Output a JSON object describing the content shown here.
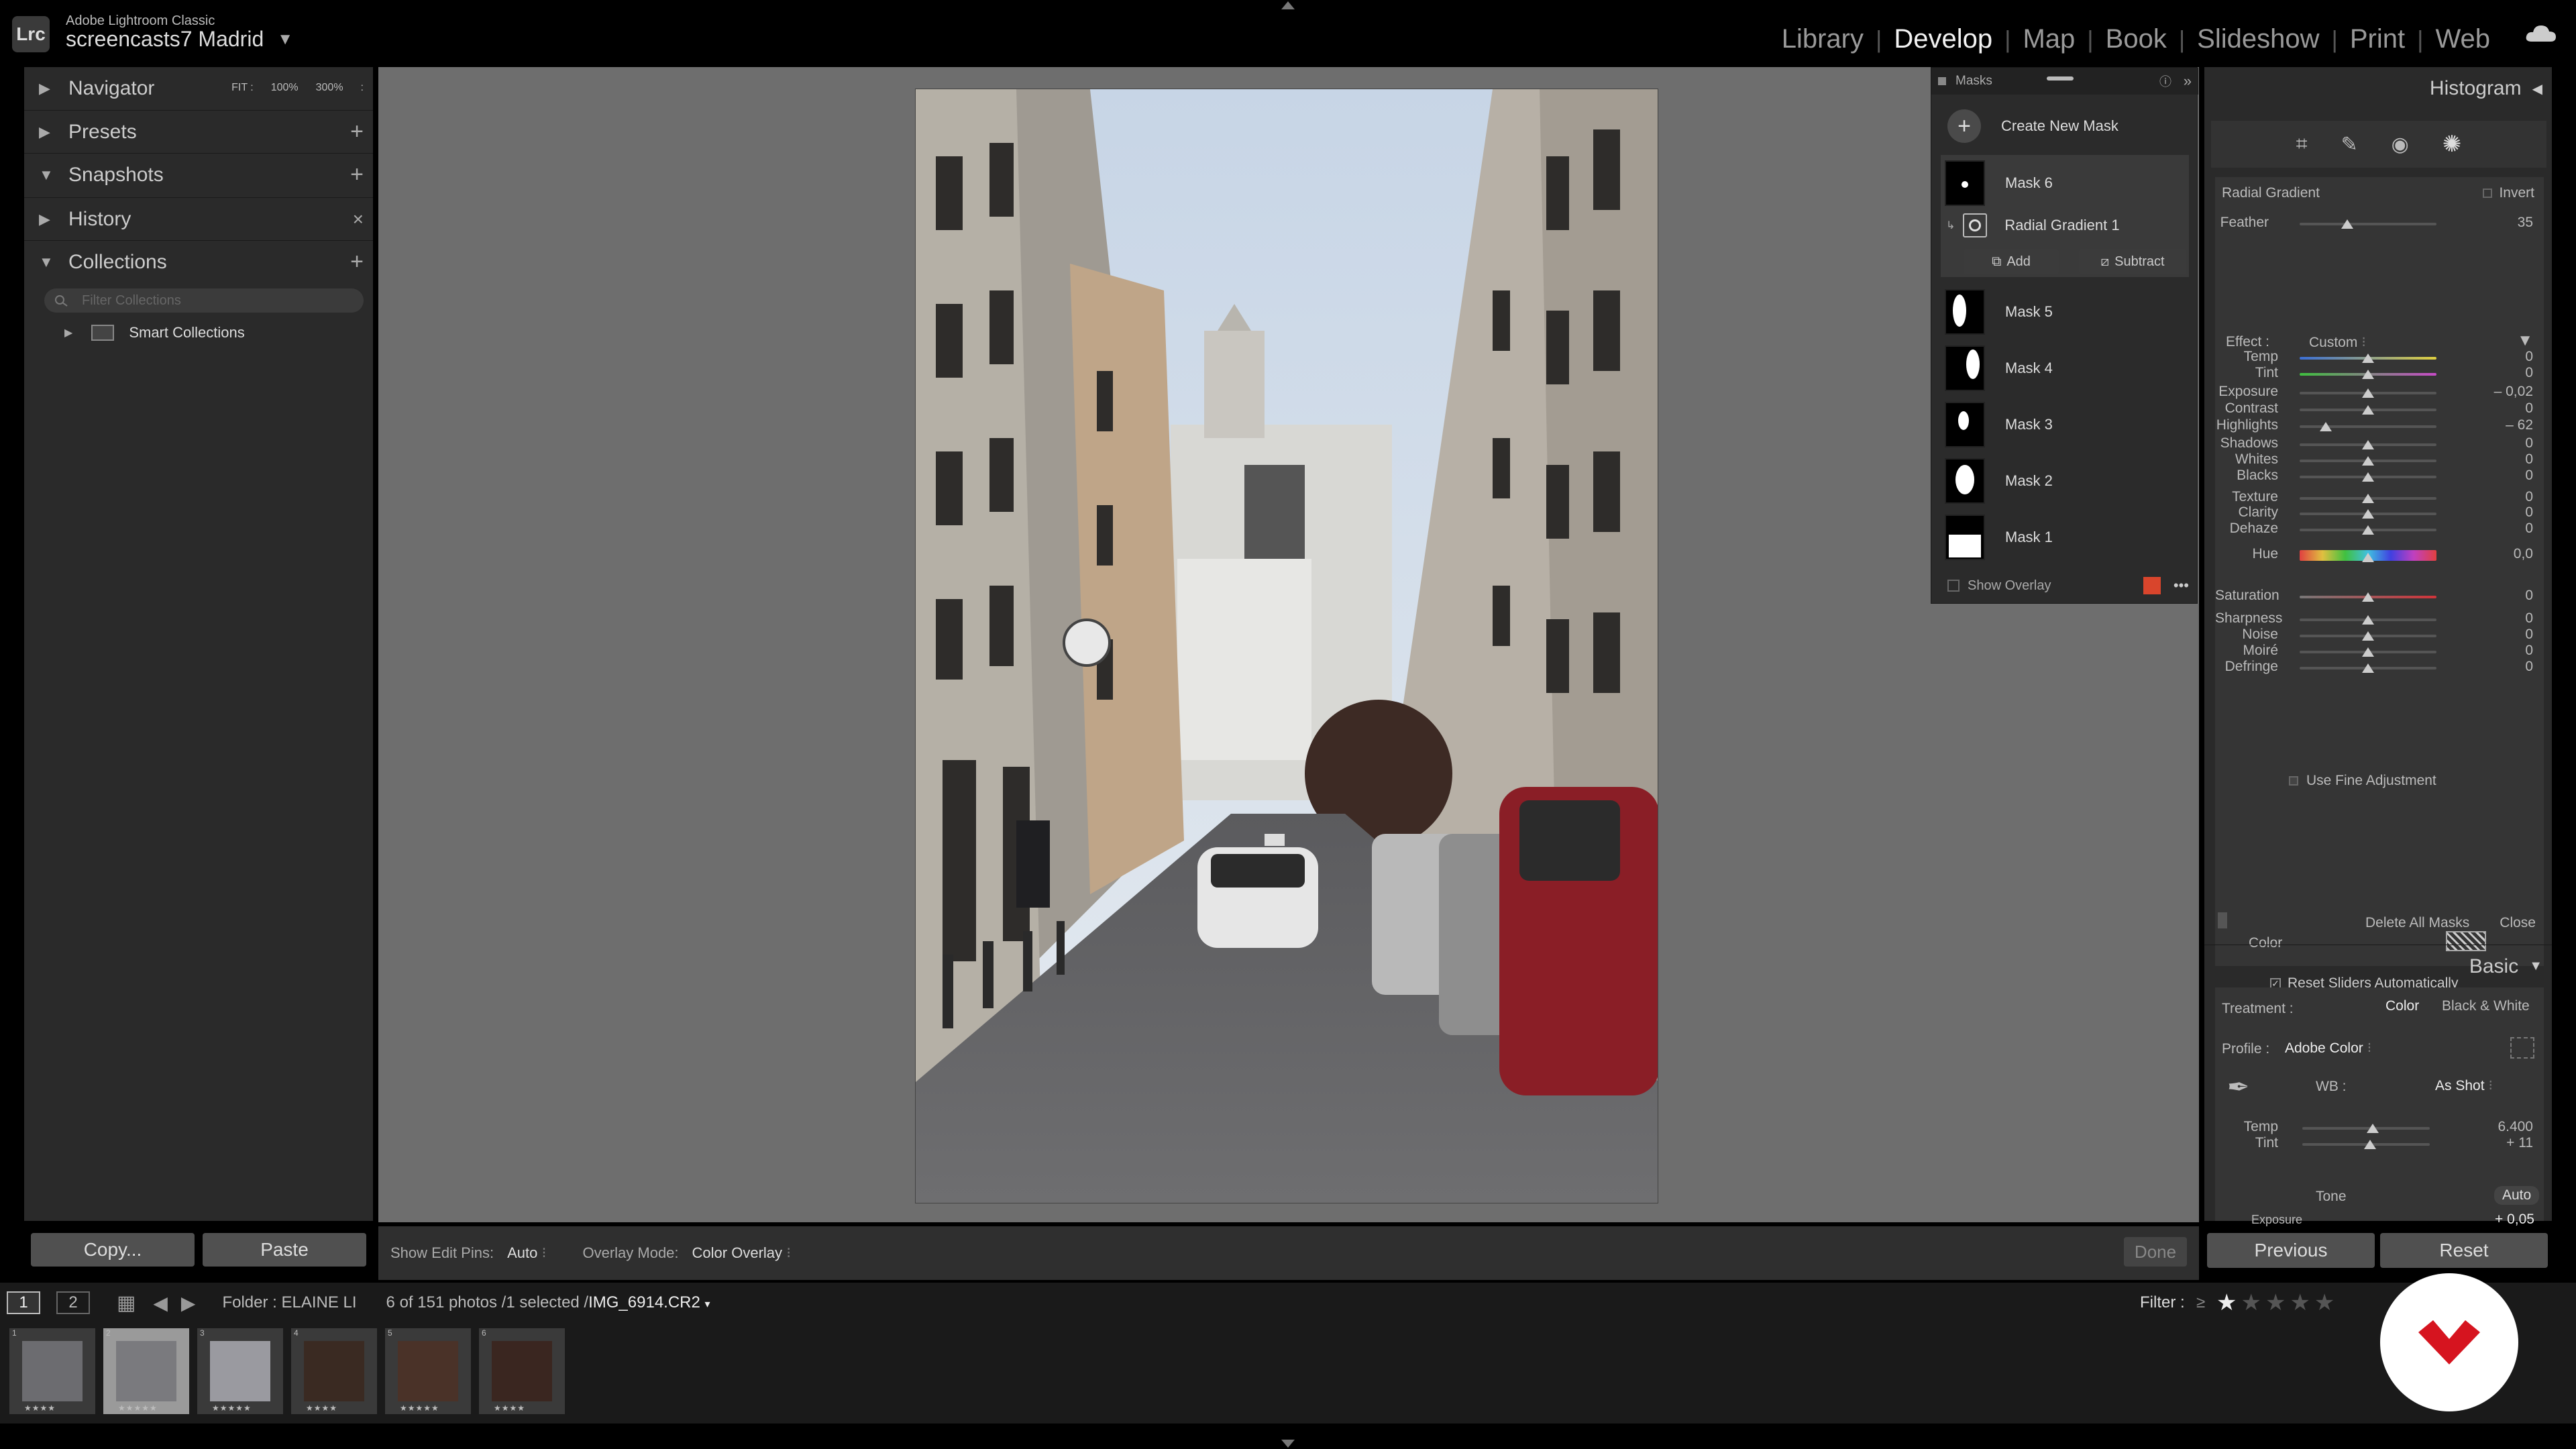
{
  "app": {
    "product": "Adobe Lightroom Classic",
    "logo_text": "Lrc",
    "catalog": "screencasts7 Madrid",
    "modules": [
      "Library",
      "Develop",
      "Map",
      "Book",
      "Slideshow",
      "Print",
      "Web"
    ],
    "active_module": "Develop"
  },
  "left_panel": {
    "navigator": {
      "label": "Navigator",
      "options": [
        "FIT :",
        "100%",
        "300%",
        ":"
      ]
    },
    "presets": {
      "label": "Presets",
      "action": "+"
    },
    "snapshots": {
      "label": "Snapshots",
      "action": "+"
    },
    "history": {
      "label": "History",
      "action": "×"
    },
    "collections": {
      "label": "Collections",
      "action": "+",
      "filter_placeholder": "Filter Collections",
      "items": [
        "Smart Collections"
      ]
    },
    "copy_label": "Copy...",
    "paste_label": "Paste"
  },
  "toolbar": {
    "show_edit_pins_label": "Show Edit Pins:",
    "show_edit_pins_value": "Auto",
    "overlay_mode_label": "Overlay Mode:",
    "overlay_mode_value": "Color Overlay",
    "done_label": "Done"
  },
  "masks": {
    "title": "Masks",
    "create_label": "Create New Mask",
    "active_mask": "Mask 6",
    "active_component": "Radial Gradient 1",
    "add_label": "Add",
    "subtract_label": "Subtract",
    "others": [
      "Mask 5",
      "Mask 4",
      "Mask 3",
      "Mask 2",
      "Mask 1"
    ],
    "show_overlay_label": "Show Overlay",
    "overlay_color": "#d9452c"
  },
  "right_panel": {
    "histogram_label": "Histogram",
    "mask_type": "Radial Gradient",
    "invert_label": "Invert",
    "feather": {
      "label": "Feather",
      "value": "35",
      "fraction": 0.35
    },
    "effect_label": "Effect :",
    "effect_value": "Custom",
    "sliders": [
      {
        "label": "Temp",
        "value": "0",
        "fraction": 0.5,
        "kind": "temp"
      },
      {
        "label": "Tint",
        "value": "0",
        "fraction": 0.5,
        "kind": "tint"
      },
      {
        "label": "Exposure",
        "value": "– 0,02",
        "fraction": 0.499
      },
      {
        "label": "Contrast",
        "value": "0",
        "fraction": 0.5
      },
      {
        "label": "Highlights",
        "value": "– 62",
        "fraction": 0.19
      },
      {
        "label": "Shadows",
        "value": "0",
        "fraction": 0.5
      },
      {
        "label": "Whites",
        "value": "0",
        "fraction": 0.5
      },
      {
        "label": "Blacks",
        "value": "0",
        "fraction": 0.5
      },
      {
        "label": "Texture",
        "value": "0",
        "fraction": 0.5
      },
      {
        "label": "Clarity",
        "value": "0",
        "fraction": 0.5
      },
      {
        "label": "Dehaze",
        "value": "0",
        "fraction": 0.5
      },
      {
        "label": "Hue",
        "value": "0,0",
        "fraction": 0.5,
        "kind": "hue"
      },
      {
        "label": "Saturation",
        "value": "0",
        "fraction": 0.5,
        "kind": "sat"
      },
      {
        "label": "Sharpness",
        "value": "0",
        "fraction": 0.5
      },
      {
        "label": "Noise",
        "value": "0",
        "fraction": 0.5
      },
      {
        "label": "Moiré",
        "value": "0",
        "fraction": 0.5
      },
      {
        "label": "Defringe",
        "value": "0",
        "fraction": 0.5
      }
    ],
    "fine_adjustment_label": "Use Fine Adjustment",
    "color_label": "Color",
    "reset_sliders_label": "Reset Sliders Automatically",
    "delete_all_label": "Delete All Masks",
    "close_label": "Close",
    "basic_label": "Basic",
    "treatment_label": "Treatment :",
    "treatment_color": "Color",
    "treatment_bw": "Black & White",
    "profile_label": "Profile :",
    "profile_value": "Adobe Color",
    "wb_label": "WB :",
    "wb_value": "As Shot",
    "basic_temp": {
      "label": "Temp",
      "value": "6.400",
      "fraction": 0.55
    },
    "basic_tint": {
      "label": "Tint",
      "value": "+ 11",
      "fraction": 0.53
    },
    "tone_label": "Tone",
    "auto_label": "Auto",
    "basic_exposure": {
      "label": "Exposure",
      "value": "+ 0,05"
    },
    "previous_label": "Previous",
    "reset_label": "Reset"
  },
  "filmbar": {
    "page1": "1",
    "page2": "2",
    "folder": "Folder : ELAINE LI",
    "count": "6 of 151 photos /1 selected /",
    "filename": "IMG_6914.CR2",
    "filter_label": "Filter :"
  },
  "filmstrip": [
    {
      "index": "1",
      "stars": "★★★★",
      "selected": false
    },
    {
      "index": "2",
      "stars": "★★★★★",
      "selected": true
    },
    {
      "index": "3",
      "stars": "★★★★★",
      "selected": false
    },
    {
      "index": "4",
      "stars": "★★★★",
      "selected": false
    },
    {
      "index": "5",
      "stars": "★★★★★",
      "selected": false
    },
    {
      "index": "6",
      "stars": "★★★★",
      "selected": false
    }
  ]
}
